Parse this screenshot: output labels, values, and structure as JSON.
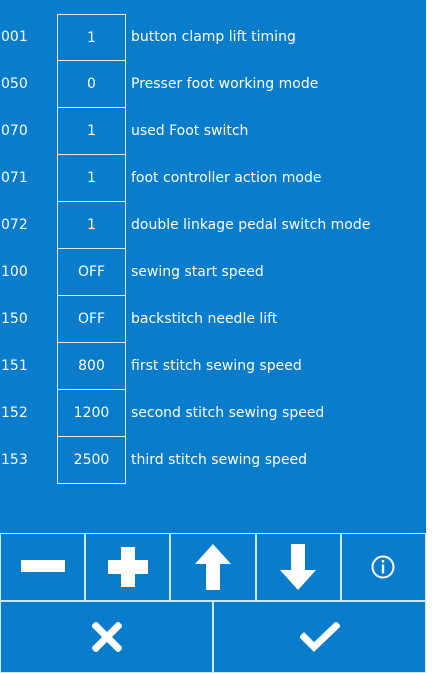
{
  "parameters": [
    {
      "code": "001",
      "value": "1",
      "description": "button clamp lift timing"
    },
    {
      "code": "050",
      "value": "0",
      "description": "Presser foot working mode"
    },
    {
      "code": "070",
      "value": "1",
      "description": "used Foot switch"
    },
    {
      "code": "071",
      "value": "1",
      "description": "foot controller action mode"
    },
    {
      "code": "072",
      "value": "1",
      "description": "double linkage pedal switch mode"
    },
    {
      "code": "100",
      "value": "OFF",
      "description": "sewing start speed"
    },
    {
      "code": "150",
      "value": "OFF",
      "description": "backstitch needle lift"
    },
    {
      "code": "151",
      "value": "800",
      "description": "first stitch sewing speed"
    },
    {
      "code": "152",
      "value": "1200",
      "description": "second stitch sewing speed"
    },
    {
      "code": "153",
      "value": "2500",
      "description": "third stitch sewing speed"
    }
  ],
  "controls": {
    "top_row_icons": [
      "minus-icon",
      "plus-icon",
      "arrow-up-icon",
      "arrow-down-icon",
      "info-icon"
    ],
    "bottom_row_icons": [
      "close-icon",
      "checkmark-icon"
    ]
  },
  "colors": {
    "background": "#0a7ccc",
    "lines": "#d6ecfb",
    "text": "#ffffff"
  }
}
